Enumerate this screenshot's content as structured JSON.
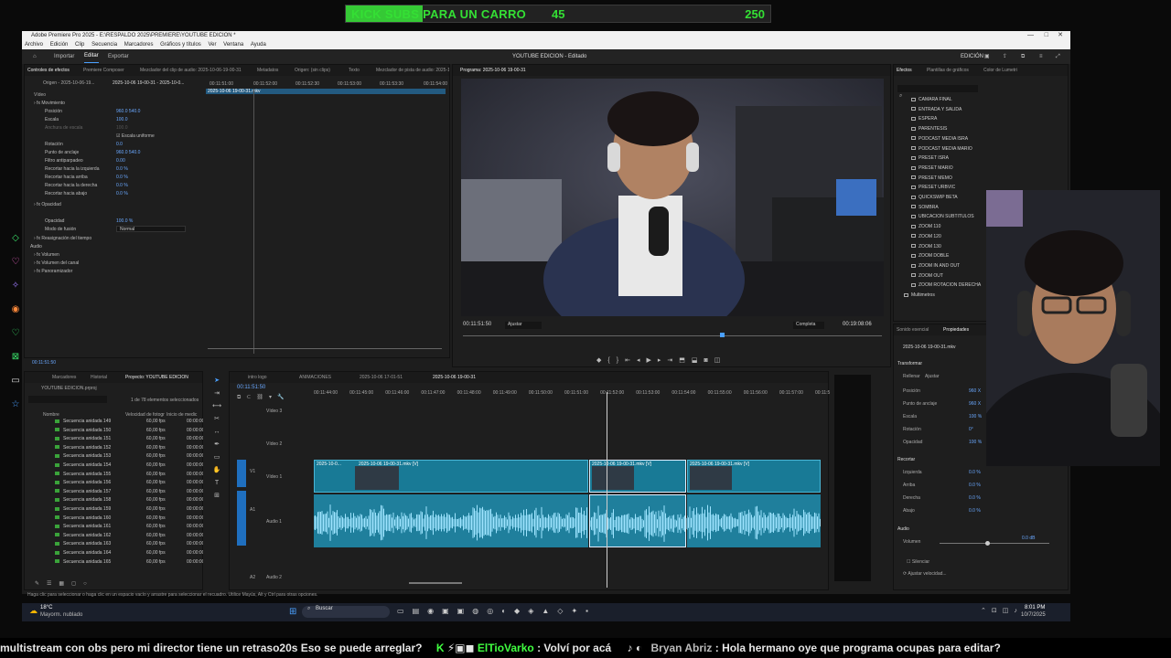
{
  "banner": {
    "text": "KICK SUBS PARA UN CARRO",
    "current": "45",
    "goal": "250",
    "progress": 0.18
  },
  "window": {
    "title": "Adobe Premiere Pro 2025 - E:\\RESPALDO 2025\\PREMIERE\\YOUTUBE EDICION *",
    "menu": [
      "Archivo",
      "Edición",
      "Clip",
      "Secuencia",
      "Marcadores",
      "Gráficos y títulos",
      "Ver",
      "Ventana",
      "Ayuda"
    ],
    "workspaces": [
      "Importar",
      "Editar",
      "Exportar"
    ],
    "center_title": "YOUTUBE EDICION - Editado",
    "edition_label": "EDICIÓN"
  },
  "effect_controls": {
    "tabs": [
      "Controles de efectos",
      "Premiere Composer",
      "Mezclador del clip de audio: 2025-10-06-19-00-31",
      "Metadatos",
      "Origen: (sin clips)",
      "Texto",
      "Mezclador de pista de audio: 2025-10-06-19-00-31"
    ],
    "source": "Origen - 2025-10-06-19...",
    "sequence": "2025-10-06 19-00-31 - 2025-10-0...",
    "ruler_times": [
      "00:11:51:00",
      "00:11:52:00",
      "00:11:52:30",
      "00:11:53:00",
      "00:11:53:30",
      "00:11:54:00"
    ],
    "clip_label": "2025-10-06 19-00-31.mkv",
    "section_video": "Vídeo",
    "rows": [
      {
        "label": "Movimiento",
        "value": ""
      },
      {
        "label": "Posición",
        "value": "960.0     540.0"
      },
      {
        "label": "Escala",
        "value": "100.0"
      },
      {
        "label": "Anchura de escala",
        "value": "100.0"
      },
      {
        "label": "Escala uniforme",
        "value": ""
      },
      {
        "label": "Rotación",
        "value": "0.0"
      },
      {
        "label": "Punto de anclaje",
        "value": "960.0     540.0"
      },
      {
        "label": "Filtro antiparpadeo",
        "value": "0.00"
      },
      {
        "label": "Recortar hacia la izquierda",
        "value": "0.0 %"
      },
      {
        "label": "Recortar hacia arriba",
        "value": "0.0 %"
      },
      {
        "label": "Recortar hacia la derecha",
        "value": "0.0 %"
      },
      {
        "label": "Recortar hacia abajo",
        "value": "0.0 %"
      },
      {
        "label": "Opacidad",
        "value": ""
      },
      {
        "label": "Opacidad",
        "value": "100.0 %"
      },
      {
        "label": "Modo de fusión",
        "value": "Normal"
      },
      {
        "label": "Reasignación del tiempo",
        "value": ""
      },
      {
        "label": "Audio",
        "value": ""
      },
      {
        "label": "Volumen",
        "value": ""
      },
      {
        "label": "Volumen del canal",
        "value": ""
      },
      {
        "label": "Panoramizador",
        "value": ""
      }
    ],
    "footer_time": "00:11:51:50"
  },
  "program": {
    "title": "Programa: 2025-10-06 19-00-31",
    "timecode": "00:11:51:50",
    "fit": "Ajustar",
    "quality": "Completa",
    "duration": "00:19:08:06"
  },
  "effects_panel": {
    "tabs": [
      "Efectos",
      "Plantillas de gráficos",
      "Color de Lumetri"
    ],
    "items": [
      "CAMARA FINAL",
      "ENTRADA Y SALIDA",
      "ESPERA",
      "PARENTESIS",
      "PODCAST MEDIA ISRA",
      "PODCAST MEDIA MARIO",
      "PRESET ISRA",
      "PRESET MARIO",
      "PRESET MEMO",
      "PRESET URBVIC",
      "QUICKSWIP BETA",
      "SOMBRA",
      "UBICACION SUBTITULOS",
      "ZOOM 110",
      "ZOOM 120",
      "ZOOM 130",
      "ZOOM DOBLE",
      "ZOOM IN AND OUT",
      "ZOOM OUT",
      "ZOOM ROTACION DERECHA",
      "Multimetros"
    ]
  },
  "properties_panel": {
    "tabs": [
      "Sonido esencial",
      "Propiedades"
    ],
    "clip": "2025-10-06 19-00-31.mkv",
    "transform": "Transformar",
    "fit_fill": [
      "Rellenar",
      "Ajustar"
    ],
    "rows": [
      {
        "label": "Posición",
        "value": "960 X"
      },
      {
        "label": "Punto de anclaje",
        "value": "960 X"
      },
      {
        "label": "Escala",
        "value": "100 %"
      },
      {
        "label": "Rotación",
        "value": "0°"
      },
      {
        "label": "Opacidad",
        "value": "100 %"
      }
    ],
    "crop": "Recortar",
    "crop_rows": [
      {
        "label": "Izquierda",
        "value": "0.0 %"
      },
      {
        "label": "Arriba",
        "value": "0.0 %"
      },
      {
        "label": "Derecha",
        "value": "0.0 %"
      },
      {
        "label": "Abajo",
        "value": "0.0 %"
      }
    ],
    "audio": "Audio",
    "volume_label": "Volumen",
    "volume_value": "0.0 dB",
    "mute": "Silenciar",
    "speed": "Ajustar velocidad..."
  },
  "project_panel": {
    "tabs": [
      "Marcadores",
      "Historial",
      "Proyecto: YOUTUBE EDICION"
    ],
    "project_file": "YOUTUBE EDICION.prproj",
    "count": "1 de 78 elementos seleccionados",
    "columns": [
      "Nombre",
      "Velocidad de fotogr",
      "Inicio de medic"
    ],
    "rows": [
      {
        "name": "Secuencia anidada 149",
        "fps": "60,00 fps",
        "start": "00:00:00:00"
      },
      {
        "name": "Secuencia anidada 150",
        "fps": "60,00 fps",
        "start": "00:00:00:00"
      },
      {
        "name": "Secuencia anidada 151",
        "fps": "60,00 fps",
        "start": "00:00:00:00"
      },
      {
        "name": "Secuencia anidada 152",
        "fps": "60,00 fps",
        "start": "00:00:00:00"
      },
      {
        "name": "Secuencia anidada 153",
        "fps": "60,00 fps",
        "start": "00:00:00:00"
      },
      {
        "name": "Secuencia anidada 154",
        "fps": "60,00 fps",
        "start": "00:00:00:00"
      },
      {
        "name": "Secuencia anidada 155",
        "fps": "60,00 fps",
        "start": "00:00:00:00"
      },
      {
        "name": "Secuencia anidada 156",
        "fps": "60,00 fps",
        "start": "00:00:00:00"
      },
      {
        "name": "Secuencia anidada 157",
        "fps": "60,00 fps",
        "start": "00:00:00:00"
      },
      {
        "name": "Secuencia anidada 158",
        "fps": "60,00 fps",
        "start": "00:00:00:00"
      },
      {
        "name": "Secuencia anidada 159",
        "fps": "60,00 fps",
        "start": "00:00:00:00"
      },
      {
        "name": "Secuencia anidada 160",
        "fps": "60,00 fps",
        "start": "00:00:00:00"
      },
      {
        "name": "Secuencia anidada 161",
        "fps": "60,00 fps",
        "start": "00:00:00:00"
      },
      {
        "name": "Secuencia anidada 162",
        "fps": "60,00 fps",
        "start": "00:00:00:00"
      },
      {
        "name": "Secuencia anidada 163",
        "fps": "60,00 fps",
        "start": "00:00:00:00"
      },
      {
        "name": "Secuencia anidada 164",
        "fps": "60,00 fps",
        "start": "00:00:00:00"
      },
      {
        "name": "Secuencia anidada 165",
        "fps": "60,00 fps",
        "start": "00:00:00:00"
      }
    ]
  },
  "timeline": {
    "tabs": [
      "intro logo",
      "ANIMACIONES",
      "2025-10-06 17-01-51",
      "2025-10-06 19-00-31"
    ],
    "timecode": "00:11:51:50",
    "ruler": [
      "00:11:44:00",
      "00:11:45:00",
      "00:11:46:00",
      "00:11:47:00",
      "00:11:48:00",
      "00:11:49:00",
      "00:11:50:00",
      "00:11:51:00",
      "00:11:52:00",
      "00:11:53:00",
      "00:11:54:00",
      "00:11:55:00",
      "00:11:56:00",
      "00:11:57:00",
      "00:11:5"
    ],
    "tracks": [
      "Vídeo 3",
      "Vídeo 2",
      "Vídeo 1",
      "Audio 1",
      "Audio 2"
    ],
    "track_codes": [
      "V3",
      "V2",
      "V1",
      "A1",
      "A2"
    ],
    "clips": [
      "2025-10-0...",
      "2025-10-06 19-00-31.mkv [V]",
      "2025-10-06 19-00-31.mkv [V]",
      "2025-10-06 19-00-31.mkv [V]"
    ]
  },
  "status_hint": "Haga clic para seleccionar o haga clic en un espacio vacío y arrastre para seleccionar el recuadro. Utilice Mayús, Alt y Ctrl para otras opciones.",
  "taskbar": {
    "weather_temp": "18°C",
    "weather_desc": "Mayorm. nublado",
    "search": "Buscar",
    "time": "8:01 PM",
    "date": "10/7/2025"
  },
  "ticker": {
    "msg1": "multistream con obs pero mi director tiene un retraso20s  Eso se puede arreglar?",
    "user1": "ElTioVarko",
    "msg2": ":  Volví por acá",
    "user2": "Bryan Abriz",
    "msg3": ":  Hola hermano oye que programa ocupas para editar?"
  },
  "colors": {
    "accent": "#4aa0ff",
    "clip": "#187a96",
    "kick": "#35c935"
  }
}
